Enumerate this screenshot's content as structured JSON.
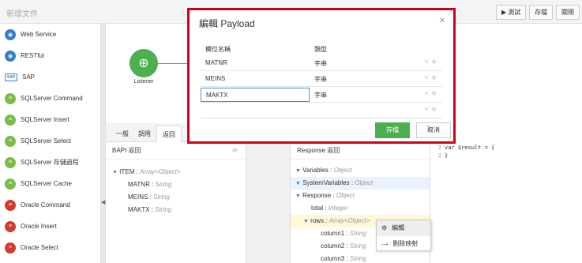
{
  "app": {
    "title": "新增文件"
  },
  "toolbar": {
    "test_label": "▶ 測試",
    "save_label": "存檔",
    "close_label": "關閉"
  },
  "sidebar": {
    "items": [
      {
        "label": "Web Service",
        "icon": "globe-icon",
        "color": "blue"
      },
      {
        "label": "RESTful",
        "icon": "rest-icon",
        "color": "blue"
      },
      {
        "label": "SAP",
        "icon": "sap-icon",
        "color": "sap"
      },
      {
        "label": "SQLServer Command",
        "icon": "database-icon",
        "color": "green"
      },
      {
        "label": "SQLServer Insert",
        "icon": "database-icon",
        "color": "green"
      },
      {
        "label": "SQLServer Select",
        "icon": "database-icon",
        "color": "green"
      },
      {
        "label": "SQLServer 存儲過程",
        "icon": "database-icon",
        "color": "green"
      },
      {
        "label": "SQLServer Cache",
        "icon": "database-icon",
        "color": "green"
      },
      {
        "label": "Oracle Command",
        "icon": "database-icon",
        "color": "red"
      },
      {
        "label": "Oracle Insert",
        "icon": "database-icon",
        "color": "red"
      },
      {
        "label": "Oracle Select",
        "icon": "database-icon",
        "color": "red"
      }
    ]
  },
  "canvas": {
    "node_label": "Listener"
  },
  "tabs": [
    "一般",
    "調用",
    "返回"
  ],
  "bapi": {
    "title": "BAPI 返回",
    "root": {
      "name": "ITEM",
      "type": "Array<Object>"
    },
    "fields": [
      {
        "name": "MATNR",
        "type": "String"
      },
      {
        "name": "MEINS",
        "type": "String"
      },
      {
        "name": "MAKTX",
        "type": "String"
      }
    ]
  },
  "response": {
    "title": "Response 返回",
    "rows": [
      {
        "name": "Variables",
        "type": "Object"
      },
      {
        "name": "SystemVariables",
        "type": "Object"
      },
      {
        "name": "Response",
        "type": "Object"
      },
      {
        "name": "total",
        "type": "Integer"
      },
      {
        "name": "rows",
        "type": "Array<Object>"
      },
      {
        "name": "column1",
        "type": "String"
      },
      {
        "name": "column2",
        "type": "String"
      },
      {
        "name": "column3",
        "type": "String"
      }
    ]
  },
  "code": {
    "lines": [
      "var $result = {",
      "}"
    ]
  },
  "context_menu": {
    "edit_label": "編輯",
    "remove_label": "刪除映射"
  },
  "modal": {
    "title": "編輯 Payload",
    "col_name": "欄位名稱",
    "col_type": "類型",
    "rows": [
      {
        "name": "MATNR",
        "type": "字串"
      },
      {
        "name": "MEINS",
        "type": "字串"
      },
      {
        "name": "MAKTX",
        "type": "字串"
      }
    ],
    "save_label": "存檔",
    "cancel_label": "取消"
  },
  "colors": {
    "accent_green": "#4caf50",
    "highlight_red": "#d0021b",
    "link_blue": "#2f7fd0"
  }
}
